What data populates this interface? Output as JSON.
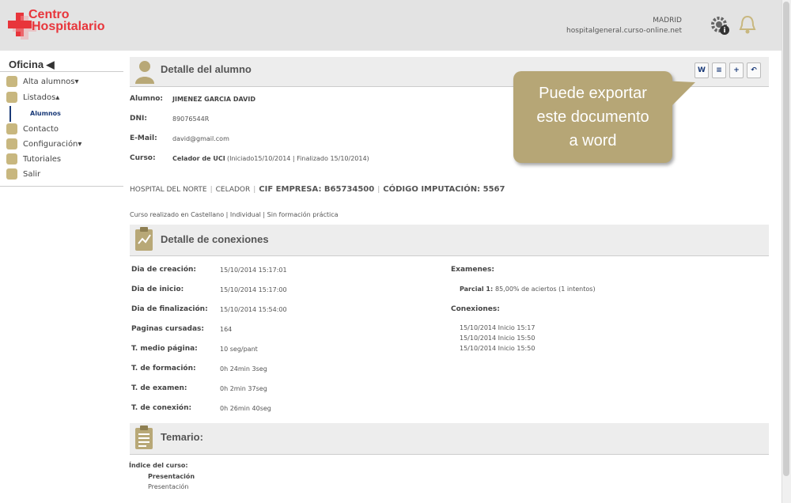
{
  "brand": {
    "line1": "Centro",
    "line2": "Hospitalario"
  },
  "header": {
    "city": "MADRID",
    "domain": "hospitalgeneral.curso-online.net",
    "icons": [
      "gear-info-icon",
      "bell-icon"
    ]
  },
  "sidebar": {
    "title": "Oficina ◀",
    "items": [
      {
        "label": "Alta alumnos▾",
        "icon": "user-icon"
      },
      {
        "label": "Listados▴",
        "icon": "list-icon"
      },
      {
        "label": "Contacto",
        "icon": "headset-icon"
      },
      {
        "label": "Configuración▾",
        "icon": "gear-icon"
      },
      {
        "label": "Tutoriales",
        "icon": "book-icon"
      },
      {
        "label": "Salir",
        "icon": "exit-icon"
      }
    ],
    "sub": "Alumnos"
  },
  "student": {
    "title": "Detalle del alumno",
    "alumno_label": "Alumno:",
    "alumno": "JIMENEZ GARCIA DAVID",
    "dni_label": "DNI:",
    "dni": "89076544R",
    "email_label": "E-Mail:",
    "email": "david@gmail.com",
    "curso_label": "Curso:",
    "curso_name": "Celador de UCI",
    "curso_dates": "(Iniciado15/10/2014 | Finalizado 15/10/2014)",
    "hospital": "HOSPITAL DEL NORTE",
    "puesto": "CELADOR",
    "cif": "CIF EMPRESA: B65734500",
    "codigo": "CÓDIGO IMPUTACIÓN: 5567",
    "course_info": "Curso realizado en Castellano | Individual | Sin formación práctica"
  },
  "tools": [
    "word-export-icon",
    "document-icon",
    "add-document-icon",
    "back-icon"
  ],
  "bubble": {
    "line1": "Puede exportar",
    "line2": "este documento",
    "line3": "a word"
  },
  "connections": {
    "title": "Detalle de conexiones",
    "rows": [
      {
        "label": "Dia de creación:",
        "value": "15/10/2014 15:17:01"
      },
      {
        "label": "Dia de inicio:",
        "value": "15/10/2014 15:17:00"
      },
      {
        "label": "Dia de finalización:",
        "value": "15/10/2014 15:54:00"
      },
      {
        "label": "Paginas cursadas:",
        "value": "164"
      },
      {
        "label": "T. medio página:",
        "value": "10 seg/pant"
      },
      {
        "label": "T. de formación:",
        "value": "0h 24min 3seg"
      },
      {
        "label": "T. de examen:",
        "value": "0h 2min 37seg"
      },
      {
        "label": "T. de conexión:",
        "value": "0h 26min 40seg"
      }
    ],
    "exams_label": "Examenes:",
    "exam_name": "Parcial 1:",
    "exam_value": "85,00% de aciertos (1 intentos)",
    "conn_label": "Conexiones:",
    "conn_list": [
      "15/10/2014 Inicio 15:17",
      "15/10/2014 Inicio 15:50",
      "15/10/2014 Inicio 15:50"
    ]
  },
  "temario": {
    "title": "Temario:",
    "index_label": "Índice del curso:",
    "section": "Presentación",
    "item": "Presentación"
  }
}
